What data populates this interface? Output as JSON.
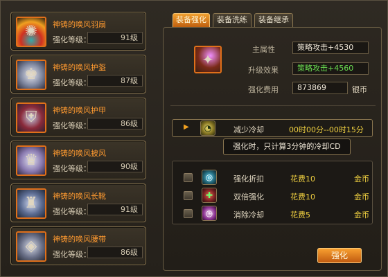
{
  "items": [
    {
      "name": "神铸的唤风羽扇",
      "level_label": "强化等级：",
      "level": "91级",
      "icon": "fan-icon"
    },
    {
      "name": "神铸的唤风护盔",
      "level_label": "强化等级：",
      "level": "87级",
      "icon": "helmet-icon"
    },
    {
      "name": "神铸的唤风护甲",
      "level_label": "强化等级：",
      "level": "86级",
      "icon": "armor-icon"
    },
    {
      "name": "神铸的唤风披风",
      "level_label": "强化等级：",
      "level": "90级",
      "icon": "cape-icon"
    },
    {
      "name": "神铸的唤风长靴",
      "level_label": "强化等级：",
      "level": "91级",
      "icon": "boots-icon"
    },
    {
      "name": "神铸的唤风腰带",
      "level_label": "强化等级：",
      "level": "86级",
      "icon": "belt-icon"
    }
  ],
  "tabs": [
    {
      "label": "装备强化",
      "active": true
    },
    {
      "label": "装备洗练",
      "active": false
    },
    {
      "label": "装备继承",
      "active": false
    }
  ],
  "detail": {
    "main_attr_label": "主属性",
    "main_attr_value": "策略攻击+4530",
    "upgrade_label": "升级效果",
    "upgrade_value": "策略攻击+4560",
    "cost_label": "强化费用",
    "cost_value": "873869",
    "cost_unit": "银币"
  },
  "cooldown": {
    "label": "减少冷却",
    "time": "00时00分--00时15分",
    "tooltip": "强化时，只计算3分钟的冷却CD"
  },
  "options": [
    {
      "label": "强化折扣",
      "cost": "花费10",
      "currency": "金币",
      "icon": "discount-icon"
    },
    {
      "label": "双倍强化",
      "cost": "花费10",
      "currency": "金币",
      "icon": "double-icon"
    },
    {
      "label": "消除冷却",
      "cost": "花费5",
      "currency": "金币",
      "icon": "clear-cooldown-icon"
    }
  ],
  "enhance_button": "强化",
  "colors": {
    "accent_orange": "#e0701a",
    "gold_text": "#f0d040",
    "green_text": "#6adc50",
    "item_name": "#ff9a30"
  }
}
